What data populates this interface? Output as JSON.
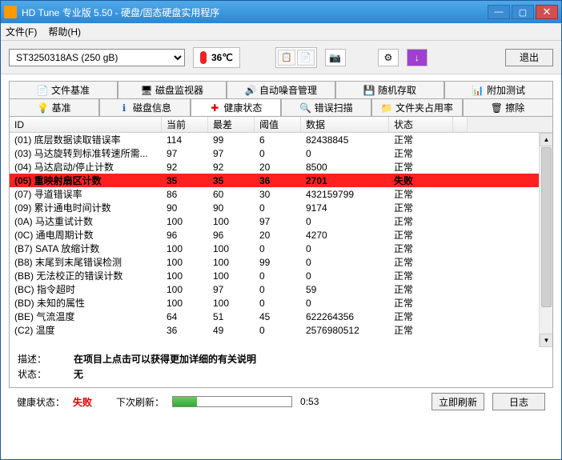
{
  "window": {
    "title": "HD Tune 专业版 5.50 - 硬盘/固态硬盘实用程序"
  },
  "menu": {
    "file": "文件(F)",
    "help": "帮助(H)"
  },
  "toolbar": {
    "drive": "ST3250318AS (250 gB)",
    "temp": "36℃",
    "exit": "退出"
  },
  "tabs_top": {
    "benchmark": "文件基准",
    "monitor": "磁盘监视器",
    "aam": "自动噪音管理",
    "random": "随机存取",
    "extra": "附加测试"
  },
  "tabs_bottom": {
    "basic": "基准",
    "info": "磁盘信息",
    "health": "健康状态",
    "errorscan": "错误扫描",
    "folder": "文件夹占用率",
    "erase": "擦除"
  },
  "columns": {
    "id": "ID",
    "current": "当前",
    "worst": "最差",
    "threshold": "阈值",
    "data": "数据",
    "status": "状态"
  },
  "rows": [
    {
      "id": "(01)",
      "name": "底层数据读取错误率",
      "cur": "114",
      "worst": "99",
      "thr": "6",
      "data": "82438845",
      "status": "正常",
      "bad": false
    },
    {
      "id": "(03)",
      "name": "马达旋转到标准转速所需...",
      "cur": "97",
      "worst": "97",
      "thr": "0",
      "data": "0",
      "status": "正常",
      "bad": false
    },
    {
      "id": "(04)",
      "name": "马达启动/停止计数",
      "cur": "92",
      "worst": "92",
      "thr": "20",
      "data": "8500",
      "status": "正常",
      "bad": false
    },
    {
      "id": "(05)",
      "name": "重映射扇区计数",
      "cur": "35",
      "worst": "35",
      "thr": "36",
      "data": "2701",
      "status": "失败",
      "bad": true
    },
    {
      "id": "(07)",
      "name": "寻道错误率",
      "cur": "86",
      "worst": "60",
      "thr": "30",
      "data": "432159799",
      "status": "正常",
      "bad": false
    },
    {
      "id": "(09)",
      "name": "累计通电时间计数",
      "cur": "90",
      "worst": "90",
      "thr": "0",
      "data": "9174",
      "status": "正常",
      "bad": false
    },
    {
      "id": "(0A)",
      "name": "马达重试计数",
      "cur": "100",
      "worst": "100",
      "thr": "97",
      "data": "0",
      "status": "正常",
      "bad": false
    },
    {
      "id": "(0C)",
      "name": "通电周期计数",
      "cur": "96",
      "worst": "96",
      "thr": "20",
      "data": "4270",
      "status": "正常",
      "bad": false
    },
    {
      "id": "(B7)",
      "name": "SATA 放缩计数",
      "cur": "100",
      "worst": "100",
      "thr": "0",
      "data": "0",
      "status": "正常",
      "bad": false
    },
    {
      "id": "(B8)",
      "name": "末尾到末尾错误检测",
      "cur": "100",
      "worst": "100",
      "thr": "99",
      "data": "0",
      "status": "正常",
      "bad": false
    },
    {
      "id": "(BB)",
      "name": "无法校正的错误计数",
      "cur": "100",
      "worst": "100",
      "thr": "0",
      "data": "0",
      "status": "正常",
      "bad": false
    },
    {
      "id": "(BC)",
      "name": "指令超时",
      "cur": "100",
      "worst": "97",
      "thr": "0",
      "data": "59",
      "status": "正常",
      "bad": false
    },
    {
      "id": "(BD)",
      "name": "未知的属性",
      "cur": "100",
      "worst": "100",
      "thr": "0",
      "data": "0",
      "status": "正常",
      "bad": false
    },
    {
      "id": "(BE)",
      "name": "气流温度",
      "cur": "64",
      "worst": "51",
      "thr": "45",
      "data": "622264356",
      "status": "正常",
      "bad": false
    },
    {
      "id": "(C2)",
      "name": "温度",
      "cur": "36",
      "worst": "49",
      "thr": "0",
      "data": "2576980512",
      "status": "正常",
      "bad": false
    }
  ],
  "desc": {
    "label_desc": "描述：",
    "desc_val": "在项目上点击可以获得更加详细的有关说明",
    "label_status": "状态：",
    "status_val": "无"
  },
  "bottom": {
    "health_label": "健康状态：",
    "health_val": "失败",
    "next_label": "下次刷新：",
    "timer": "0:53",
    "refresh": "立即刷新",
    "log": "日志"
  }
}
